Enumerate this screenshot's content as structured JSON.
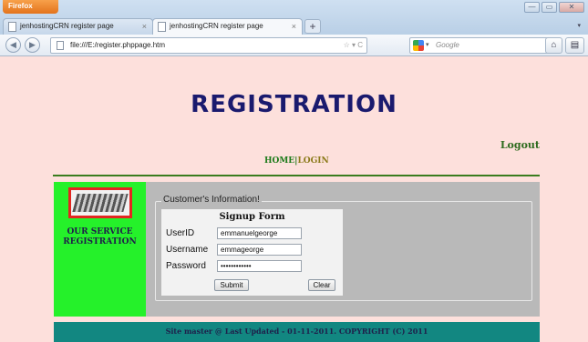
{
  "browser": {
    "menu_button": "Firefox",
    "window_controls": {
      "minimize": "—",
      "restore": "▭",
      "close": "✕"
    },
    "tabs": [
      {
        "title": "jenhostingCRN register page",
        "close": "×"
      },
      {
        "title": "jenhostingCRN register page",
        "close": "×"
      }
    ],
    "new_tab": "+",
    "url": "file:///E:/register.phppage.htm",
    "url_icons": "☆ ▾ C",
    "search_placeholder": "Google",
    "search_dropdown": "▾",
    "search_icon": "🔍",
    "icons": [
      "back-icon",
      "forward-icon",
      "home-icon",
      "toolbar-menu-icon"
    ]
  },
  "page": {
    "title": "REGISTRATION",
    "logout": "Logout",
    "nav": {
      "home": "HOME",
      "separator": "|",
      "login": "LOGIN"
    },
    "service_label_line1": "OUR SERVICE",
    "service_label_line2": "REGISTRATION",
    "fieldset_legend": "Customer's Information!",
    "form": {
      "heading": "Signup Form",
      "userid_label": "UserID",
      "userid_value": "emmanuelgeorge",
      "username_label": "Username",
      "username_value": "emmageorge",
      "password_label": "Password",
      "password_value": "••••••••••••",
      "submit_label": "Submit",
      "clear_label": "Clear"
    },
    "footer": "Site master @ Last Updated - 01-11-2011. COPYRIGHT (C) 2011"
  },
  "colors": {
    "page_bg": "#fde0dc",
    "title": "#1a1a6e",
    "left_column": "#25f12a",
    "right_column": "#b9b9b9",
    "footer": "#128781",
    "divider": "#3a7c1e"
  }
}
